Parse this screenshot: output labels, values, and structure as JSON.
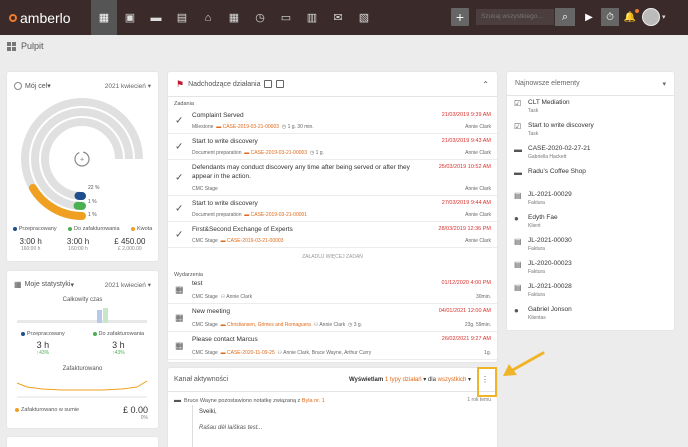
{
  "topbar": {
    "logo": "amberlo",
    "search_placeholder": "Szukaj wszystkiego...",
    "nav_icons": [
      "dashboard-icon",
      "contacts-icon",
      "briefcase-icon",
      "document-icon",
      "bank-icon",
      "calendar-icon",
      "history-icon",
      "folder-icon",
      "billing-icon",
      "mail-icon",
      "reports-icon"
    ]
  },
  "page": {
    "title": "Pulpit"
  },
  "goal": {
    "title": "Mój cel",
    "period": "2021 kwiecień",
    "ring_pcts": [
      "22 %",
      "1 %",
      "1 %"
    ],
    "legend": [
      {
        "label": "Przepracowany",
        "color": "#1f4e8c"
      },
      {
        "label": "Do zafakturowania",
        "color": "#4caf50"
      },
      {
        "label": "Kwota",
        "color": "#f0a020"
      }
    ],
    "values": [
      {
        "v": "3:00 h",
        "sub": "160:00 h"
      },
      {
        "v": "3:00 h",
        "sub": "160:00 h"
      },
      {
        "v": "£ 450.00",
        "sub": "£ 2,000.00"
      }
    ],
    "progress": [
      0.22,
      0.01,
      0.01
    ]
  },
  "stats": {
    "title": "Moje statystyki",
    "period": "2021 kwiecień",
    "total_time": "Całkowity czas",
    "cols": [
      {
        "label": "Przepracowany",
        "value": "3 h",
        "pct": "↑43%",
        "color": "#1f4e8c"
      },
      {
        "label": "Do zafakturowania",
        "value": "3 h",
        "pct": "↑43%",
        "color": "#4caf50"
      }
    ],
    "invoiced_label": "Zafakturowano",
    "invoiced_sum_label": "Zafakturowano w sumie",
    "invoiced_sum": "£ 0.00",
    "invoiced_pct": "0%"
  },
  "upcoming": {
    "title": "Nadchodzące działania",
    "tasks_label": "Zadania",
    "events_label": "Wydarzenia",
    "load_more": "ZAŁADUJ WIĘCEJ ZADAŃ",
    "tasks": [
      {
        "title": "Complaint Served",
        "type": "Milestone",
        "case": "CASE-2019-03-21-00003",
        "extra": "1 g. 30 min.",
        "date": "21/03/2019 9:39 AM",
        "person": "Annie Clark"
      },
      {
        "title": "Start to write discovery",
        "type": "Document preparation",
        "case": "CASE-2019-03-21-00003",
        "extra": "1 g.",
        "date": "21/03/2019 9:43 AM",
        "person": "Annie Clark"
      },
      {
        "title": "Defendants may conduct discovery any time after being served or after they appear in the action.",
        "type": "CMC Stage",
        "case": "",
        "extra": "",
        "date": "25/03/2019 10:52 AM",
        "person": "Annie Clark"
      },
      {
        "title": "Start to write discovery",
        "type": "Document preparation",
        "case": "CASE-2019-03-21-00001",
        "extra": "",
        "date": "27/03/2019 9:44 AM",
        "person": "Annie Clark"
      },
      {
        "title": "First&Second Exchange of Experts",
        "type": "CMC Stage",
        "case": "CASE-2019-03-21-00003",
        "extra": "",
        "date": "28/03/2019 12:36 PM",
        "person": "Annie Clark"
      }
    ],
    "events": [
      {
        "title": "test",
        "meta": "CMC Stage",
        "people": "Annie Clark",
        "case": "",
        "extra": "",
        "date": "01/12/2020 4:00 PM",
        "right2": "30min."
      },
      {
        "title": "New meeting",
        "meta": "CMC Stage",
        "case": "Christiansen, Grimes and Romaguera",
        "people": "Annie Clark",
        "extra": "3 g.",
        "date": "04/01/2021 12:00 AM",
        "right2": "23g. 59min."
      },
      {
        "title": "Please contact Marcus",
        "meta": "CMC Stage",
        "case": "CASE-2020-11-09-25",
        "people": "Annie Clark, Bruce Wayne, Arthur Curry",
        "extra": "",
        "date": "26/02/2021 9:27 AM",
        "right2": "1g."
      }
    ]
  },
  "activity": {
    "title": "Kanał aktywności",
    "filter_prefix": "Wyświetlam",
    "filter_count": "1 typy działań",
    "filter_mid": "dla",
    "filter_all": "wszystkich",
    "entry_text": "Bruce Wayne pozostawiono notatkę związaną z",
    "entry_link": "Byla nr. 1",
    "entry_time": "1 rok temu",
    "note_line1": "Sveiki,",
    "note_line2": "Rašau dėl laiškas test..."
  },
  "recent": {
    "title": "Najnowsze elementy",
    "items": [
      {
        "title": "CLT Mediation",
        "sub": "Task",
        "icon": "task-icon"
      },
      {
        "title": "Start to write discovery",
        "sub": "Task",
        "icon": "task-icon"
      },
      {
        "title": "CASE-2020-02-27-21",
        "sub": "Gabriella Hackett",
        "icon": "briefcase-icon"
      },
      {
        "title": "Radu's Coffee Shop",
        "sub": "",
        "icon": "briefcase-icon"
      },
      {
        "title": "JL-2021-00029",
        "sub": "Faktura",
        "icon": "invoice-icon"
      },
      {
        "title": "Edyth Fae",
        "sub": "Klient",
        "icon": "person-icon"
      },
      {
        "title": "JL-2021-00030",
        "sub": "Faktura",
        "icon": "invoice-icon"
      },
      {
        "title": "JL-2020-00023",
        "sub": "Faktura",
        "icon": "invoice-icon"
      },
      {
        "title": "JL-2021-00028",
        "sub": "Faktura",
        "icon": "invoice-icon"
      },
      {
        "title": "Gabriel Jonson",
        "sub": "Klientas",
        "icon": "person-icon"
      }
    ]
  }
}
